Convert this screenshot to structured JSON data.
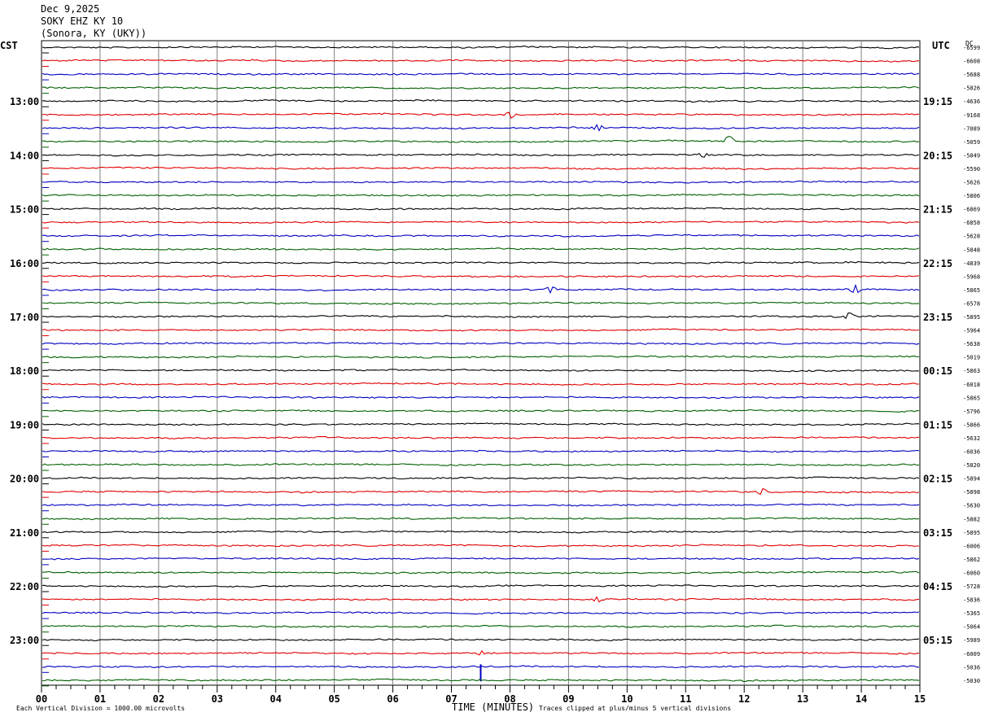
{
  "header": {
    "date": "Dec 9,2025",
    "station": "SOKY EHZ KY 10",
    "location": "(Sonora, KY (UKY))"
  },
  "left_tz": "CST",
  "right_tz": "UTC",
  "dc_label": "DC",
  "footer": {
    "scale": "Each Vertical Division = 1000.00 microvolts",
    "xlabel": "TIME (MINUTES)",
    "clip_note": "Traces clipped at plus/minus 5 vertical divisions"
  },
  "colors": {
    "trace": [
      "#000000",
      "#e00000",
      "#0000c0",
      "#006000"
    ],
    "grid": "#808080"
  },
  "chart_data": {
    "type": "line",
    "title": "SOKY EHZ KY 10",
    "xlabel": "TIME (MINUTES)",
    "xlim": [
      0,
      15
    ],
    "x_ticks": [
      "00",
      "01",
      "02",
      "03",
      "04",
      "05",
      "06",
      "07",
      "08",
      "09",
      "10",
      "11",
      "12",
      "13",
      "14",
      "15"
    ],
    "left_hour_labels": [
      "13:00",
      "14:00",
      "15:00",
      "16:00",
      "17:00",
      "18:00",
      "19:00",
      "20:00",
      "21:00",
      "22:00",
      "23:00"
    ],
    "right_hour_labels": [
      "19:15",
      "20:15",
      "21:15",
      "22:15",
      "23:15",
      "00:15",
      "01:15",
      "02:15",
      "03:15",
      "04:15",
      "05:15"
    ],
    "trace_count": 48,
    "dc_offsets": [
      "-6599",
      "-6608",
      "-5688",
      "-5826",
      "-4636",
      "-9168",
      "-7089",
      "-5059",
      "-5849",
      "-5590",
      "-5626",
      "-5806",
      "-6869",
      "-6858",
      "-5628",
      "-5848",
      "-4839",
      "-5968",
      "-5865",
      "-6578",
      "-5895",
      "-5964",
      "-5638",
      "-5019",
      "-5863",
      "-6018",
      "-5865",
      "-5796",
      "-5866",
      "-5632",
      "-6036",
      "-5820",
      "-5894",
      "-5898",
      "-5630",
      "-5882",
      "-5895",
      "-6006",
      "-5862",
      "-6060",
      "-5728",
      "-5836",
      "-5365",
      "-5064",
      "-5989",
      "-6009",
      "-5036",
      "-5030"
    ],
    "events": [
      {
        "trace": 5,
        "minute": 8.0,
        "amp": -4
      },
      {
        "trace": 6,
        "minute": 9.5,
        "amp": -5
      },
      {
        "trace": 7,
        "minute": 11.75,
        "amp": 7
      },
      {
        "trace": 8,
        "minute": 11.3,
        "amp": -3
      },
      {
        "trace": 18,
        "minute": 8.7,
        "amp": -4
      },
      {
        "trace": 18,
        "minute": 13.9,
        "amp": -5
      },
      {
        "trace": 20,
        "minute": 13.8,
        "amp": -5
      },
      {
        "trace": 33,
        "minute": 12.3,
        "amp": -4
      },
      {
        "trace": 41,
        "minute": 9.5,
        "amp": -3
      },
      {
        "trace": 45,
        "minute": 7.5,
        "amp": -3
      },
      {
        "trace": 46,
        "minute": 7.5,
        "amp": 18
      }
    ]
  }
}
